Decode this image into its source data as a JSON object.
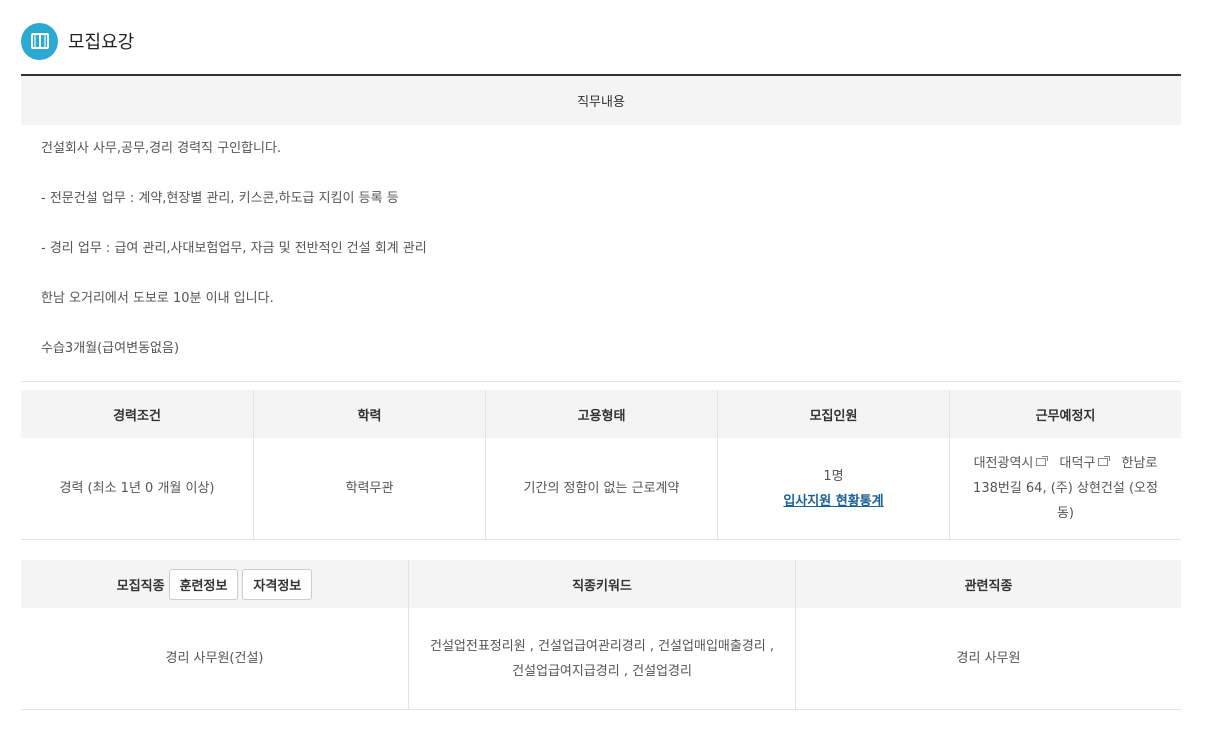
{
  "header": {
    "title": "모집요강",
    "icon": "book-icon",
    "icon_color": "#2aa9d2"
  },
  "job_description": {
    "heading": "직무내용",
    "lines": [
      "건설회사 사무,공무,경리 경력직 구인합니다.",
      "- 전문건설 업무 : 계약,현장별 관리, 키스콘,하도급 지킴이 등록 등",
      "- 경리 업무 : 급여 관리,사대보험업무, 자금 및 전반적인 건설 회계 관리",
      "한남 오거리에서 도보로 10분 이내 입니다.",
      "수습3개월(급여변동없음)"
    ]
  },
  "conditions": {
    "headers": [
      "경력조건",
      "학력",
      "고용형태",
      "모집인원",
      "근무예정지"
    ],
    "experience": "경력 (최소 1년 0 개월 이상)",
    "education": "학력무관",
    "employment_type": "기간의 정함이 없는 근로계약",
    "headcount": "1명",
    "applicant_stats_link": "입사지원 현황통계",
    "location": {
      "city": "대전광역시",
      "district": "대덕구",
      "address": "한남로138번길 64, (주) 상현건설",
      "dong": "(오정동)"
    }
  },
  "job_info": {
    "headers": {
      "occupation": "모집직종",
      "keywords": "직종키워드",
      "related": "관련직종"
    },
    "buttons": {
      "training": "훈련정보",
      "certification": "자격정보"
    },
    "occupation": "경리 사무원(건설)",
    "keywords": "건설업전표정리원 , 건설업급여관리경리 , 건설업매입매출경리 , 건설업급여지급경리 , 건설업경리",
    "related": "경리 사무원"
  }
}
